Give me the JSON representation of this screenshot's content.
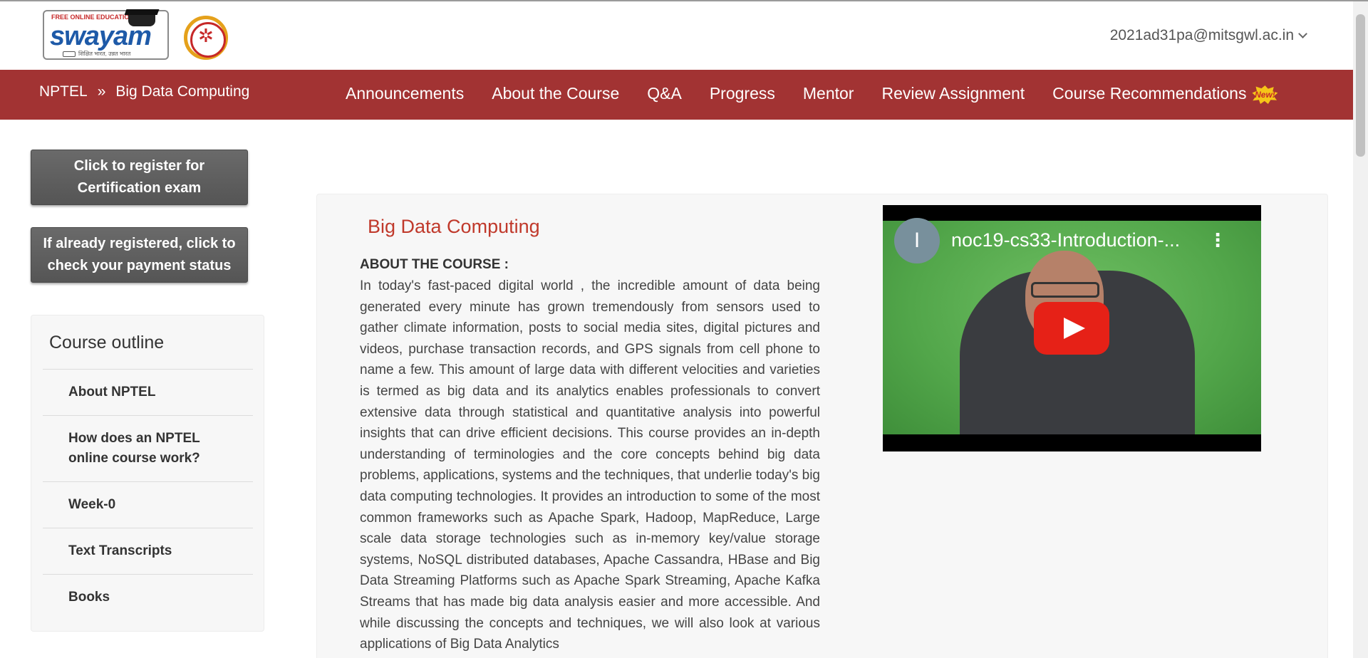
{
  "header": {
    "logo_tagline": "FREE ONLINE EDUCATION",
    "logo_word": "swayam",
    "logo_sub": "शिक्षित भारत, उन्नत भारत",
    "user_email": "2021ad31pa@mitsgwl.ac.in"
  },
  "breadcrumb": {
    "root": "NPTEL",
    "separator": "»",
    "current": "Big Data Computing"
  },
  "nav": {
    "items": [
      "Announcements",
      "About the Course",
      "Q&A",
      "Progress",
      "Mentor",
      "Review Assignment",
      "Course Recommendations"
    ],
    "new_badge": "New!"
  },
  "sidebar": {
    "register_button": "Click to register for Certification exam",
    "payment_button": "If already registered, click to check your payment status",
    "outline_title": "Course outline",
    "outline_items": [
      "About NPTEL",
      "How does an NPTEL online course work?",
      "Week-0",
      "Text Transcripts",
      "Books"
    ]
  },
  "main": {
    "course_title": "Big Data Computing",
    "about_heading": "ABOUT THE COURSE :",
    "about_text": "In today's fast-paced digital world , the incredible amount of data being generated every minute has grown tremendously from sensors used to gather climate information, posts to social media sites, digital pictures and videos, purchase transaction records, and GPS signals from cell phone to name a few. This amount of large data with different velocities and varieties is termed as big data and its analytics enables professionals to convert extensive data through statistical and quantitative analysis into powerful insights that can drive efficient decisions. This course provides an in-depth understanding of terminologies and the core concepts behind big data problems, applications, systems and the techniques, that underlie today's big data computing technologies. It provides an introduction to some of the most common frameworks such as Apache Spark, Hadoop, MapReduce, Large scale data storage technologies such as in-memory key/value storage systems, NoSQL distributed databases, Apache Cassandra, HBase and Big Data Streaming Platforms such as Apache Spark Streaming, Apache Kafka Streams that has made big data analysis easier and more accessible. And while discussing the concepts and techniques, we will also look at various applications of Big Data Analytics"
  },
  "video": {
    "channel_initial": "I",
    "title": "noc19-cs33-Introduction-...",
    "menu_glyph": "⋮"
  },
  "colors": {
    "navbar": "#a23333",
    "course_title": "#c0392b",
    "button_gray": "#5d5d5d",
    "youtube_red": "#e62117"
  },
  "icons": {
    "user_menu": "chevron-down-icon",
    "play": "play-icon",
    "video_menu": "more-vert-icon"
  }
}
